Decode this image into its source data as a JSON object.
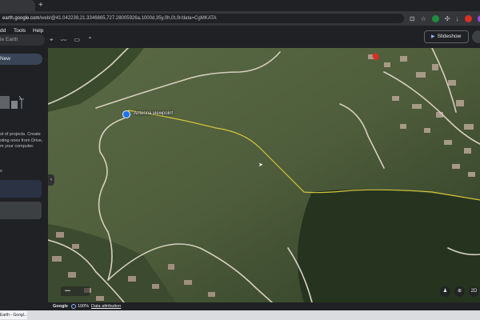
{
  "browser": {
    "new_tab_glyph": "+",
    "url_host": "earth.google.com",
    "url_path": "/web/@41.042239,21.3346865,727.28005926a,1000d,35y,0h,0t,0r/data=CgMKATA",
    "icons": [
      "install-app-icon",
      "star-icon",
      "extension-icon",
      "profile-avatar"
    ]
  },
  "app": {
    "menu": [
      {
        "label": "dd"
      },
      {
        "label": "Tools"
      },
      {
        "label": "Help"
      }
    ],
    "search_placeholder": "le Earth",
    "slideshow_label": "Slideshow",
    "accent_color": "#8ab4f8"
  },
  "sidebar": {
    "new_button_label": "New",
    "empty_text": "st of projects. Create sting ones from Drive, m your computer.",
    "section_label": "s",
    "collapse_glyph": "‹"
  },
  "map": {
    "placemark_label": "Antenna viewpoint",
    "path_color": "#d4c53a",
    "minimap_label": "••••",
    "controls": [
      "pegman-icon",
      "compass-icon",
      "2D"
    ]
  },
  "status": {
    "brand": "Google",
    "load_percent": "100%",
    "attribution": "Data attribution"
  },
  "taskbar": {
    "item_label": "Earth - Googl..."
  }
}
